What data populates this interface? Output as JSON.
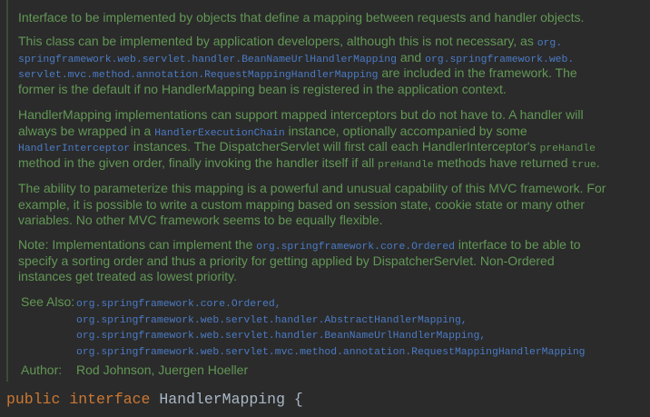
{
  "colors": {
    "background": "#2b2b2b",
    "doc_text": "#629755",
    "link": "#4b7bc6",
    "keyword": "#cc7832",
    "identifier": "#a9b7c6"
  },
  "paragraphs": [
    [
      [
        {
          "t": "Interface to be implemented by objects that define a mapping between requests and handler objects.",
          "k": "text"
        }
      ]
    ],
    [
      [
        {
          "t": "This class can be implemented by application developers, although this is not necessary, as ",
          "k": "text"
        },
        {
          "t": "org.",
          "k": "link"
        }
      ],
      [
        {
          "t": "springframework.web.servlet.handler.BeanNameUrlHandlerMapping",
          "k": "link"
        },
        {
          "t": " and ",
          "k": "text"
        },
        {
          "t": "org.springframework.web.",
          "k": "link"
        }
      ],
      [
        {
          "t": "servlet.mvc.method.annotation.RequestMappingHandlerMapping",
          "k": "link"
        },
        {
          "t": " are included in the framework. The",
          "k": "text"
        }
      ],
      [
        {
          "t": "former is the default if no HandlerMapping bean is registered in the application context.",
          "k": "text"
        }
      ]
    ],
    [
      [
        {
          "t": "HandlerMapping implementations can support mapped interceptors but do not have to. A handler will",
          "k": "text"
        }
      ],
      [
        {
          "t": "always be wrapped in a ",
          "k": "text"
        },
        {
          "t": "HandlerExecutionChain",
          "k": "link"
        },
        {
          "t": " instance, optionally accompanied by some",
          "k": "text"
        }
      ],
      [
        {
          "t": "HandlerInterceptor",
          "k": "link"
        },
        {
          "t": " instances. The DispatcherServlet will first call each HandlerInterceptor's ",
          "k": "text"
        },
        {
          "t": "preHandle",
          "k": "code"
        }
      ],
      [
        {
          "t": "method in the given order, finally invoking the handler itself if all ",
          "k": "text"
        },
        {
          "t": "preHandle",
          "k": "code"
        },
        {
          "t": " methods have returned ",
          "k": "text"
        },
        {
          "t": "true",
          "k": "code"
        },
        {
          "t": ".",
          "k": "text"
        }
      ]
    ],
    [
      [
        {
          "t": "The ability to parameterize this mapping is a powerful and unusual capability of this MVC framework. For",
          "k": "text"
        }
      ],
      [
        {
          "t": "example, it is possible to write a custom mapping based on session state, cookie state or many other",
          "k": "text"
        }
      ],
      [
        {
          "t": "variables. No other MVC framework seems to be equally flexible.",
          "k": "text"
        }
      ]
    ],
    [
      [
        {
          "t": "Note: Implementations can implement the ",
          "k": "text"
        },
        {
          "t": "org.springframework.core.Ordered",
          "k": "link"
        },
        {
          "t": " interface to be able to",
          "k": "text"
        }
      ],
      [
        {
          "t": "specify a sorting order and thus a priority for getting applied by DispatcherServlet. Non-Ordered",
          "k": "text"
        }
      ],
      [
        {
          "t": "instances get treated as lowest priority.",
          "k": "text"
        }
      ]
    ]
  ],
  "see_also": {
    "label": "See Also:",
    "links": [
      "org.springframework.core.Ordered,",
      "org.springframework.web.servlet.handler.AbstractHandlerMapping,",
      "org.springframework.web.servlet.handler.BeanNameUrlHandlerMapping,",
      "org.springframework.web.servlet.mvc.method.annotation.RequestMappingHandlerMapping"
    ]
  },
  "author": {
    "label": "Author:",
    "value": "Rod Johnson, Juergen Hoeller"
  },
  "code": {
    "kw1": "public",
    "kw2": "interface",
    "name": "HandlerMapping",
    "brace": "{"
  }
}
